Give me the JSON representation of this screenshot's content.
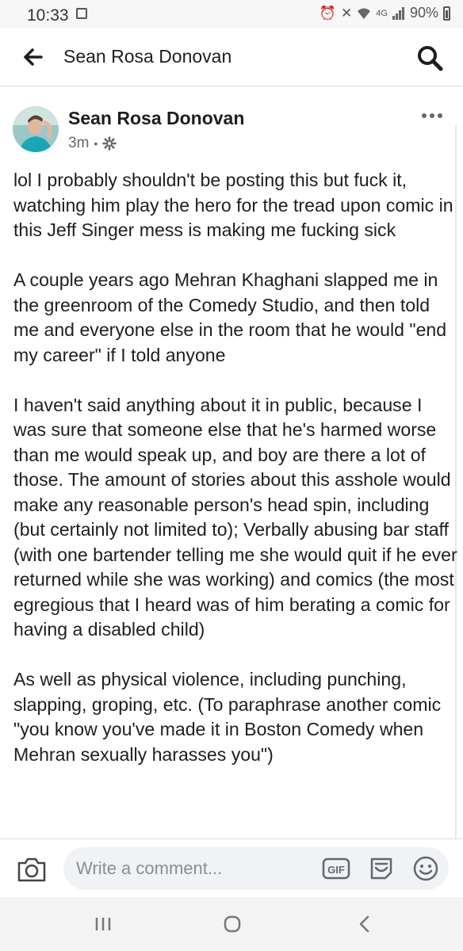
{
  "status_bar": {
    "time": "10:33",
    "network": "4G",
    "battery": "90%"
  },
  "app_bar": {
    "title": "Sean Rosa Donovan"
  },
  "post": {
    "author": "Sean Rosa Donovan",
    "timestamp": "3m",
    "separator": "•",
    "paragraphs": [
      "lol I probably shouldn't be posting this but fuck it, watching him play the hero for the tread upon comic in this Jeff Singer mess is making me fucking sick",
      "A couple years ago Mehran Khaghani slapped me in the greenroom of the Comedy Studio, and then told me and everyone else in the room that he would \"end my career\" if I told anyone",
      "I haven't said anything about it in public, because I was sure that someone else that he's harmed worse than me would speak up, and boy are there a lot of those. The amount of stories about this asshole would make any reasonable person's head spin, including (but certainly not limited to); Verbally abusing bar staff (with one bartender telling me she would quit if he ever returned while she was working) and comics (the most egregious that I heard was of him berating a comic for having a disabled child)",
      "As well as physical violence, including punching, slapping, groping, etc. (To paraphrase another comic \"you know you've made it in Boston Comedy when Mehran sexually harasses you\")"
    ]
  },
  "comment_bar": {
    "placeholder": "Write a comment...",
    "gif_label": "GIF"
  }
}
